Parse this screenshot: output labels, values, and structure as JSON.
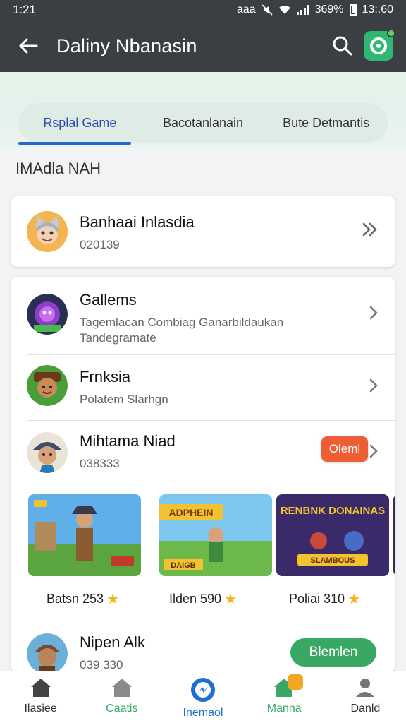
{
  "status": {
    "time": "1:21",
    "icons_text": "aaa",
    "battery": "369%",
    "clock": "13:.60"
  },
  "appbar": {
    "title": "Daliny Nbanasin",
    "back_icon": "arrow-left-icon",
    "search_icon": "search-icon"
  },
  "tabs": [
    {
      "label": "Rsplal Game",
      "active": true
    },
    {
      "label": "Bacotanlanain",
      "active": false
    },
    {
      "label": "Bute Detmantis",
      "active": false
    }
  ],
  "section": {
    "title": "IMAdla NAH"
  },
  "featured": {
    "title": "Banhaai Inlasdia",
    "sub": "020139"
  },
  "list": [
    {
      "title": "Gallems",
      "sub": "Tagemlacan Combiag Ganarbildaukan Tandegramate"
    },
    {
      "title": "Frnksia",
      "sub": "Polatem Slarhgn"
    },
    {
      "title": "Mihtama Niad",
      "sub": "038333",
      "badge": "Oleml"
    }
  ],
  "games": [
    {
      "label": "Batsn 253",
      "art_text": ""
    },
    {
      "label": "Ilden 590",
      "art_text": "ADPHEIN",
      "art_sub": "DAIGB"
    },
    {
      "label": "Poliai 310",
      "art_text": "RENBNK DONAINAS",
      "art_sub": "SLAMBOUS"
    }
  ],
  "last": {
    "title": "Nipen Alk",
    "sub": "039 330",
    "button": "Blemlen"
  },
  "nav": [
    {
      "label": "Ilasiee",
      "color": "#333333"
    },
    {
      "label": "Caatis",
      "color": "#3aa865"
    },
    {
      "label": "Inemaol",
      "color": "#1f6fd1"
    },
    {
      "label": "Manna",
      "color": "#3aa865"
    },
    {
      "label": "Danld",
      "color": "#333333"
    }
  ],
  "colors": {
    "appbar": "#3b3f44",
    "accent_blue": "#2767c6",
    "badge": "#ef5d34",
    "green": "#3aa865"
  }
}
